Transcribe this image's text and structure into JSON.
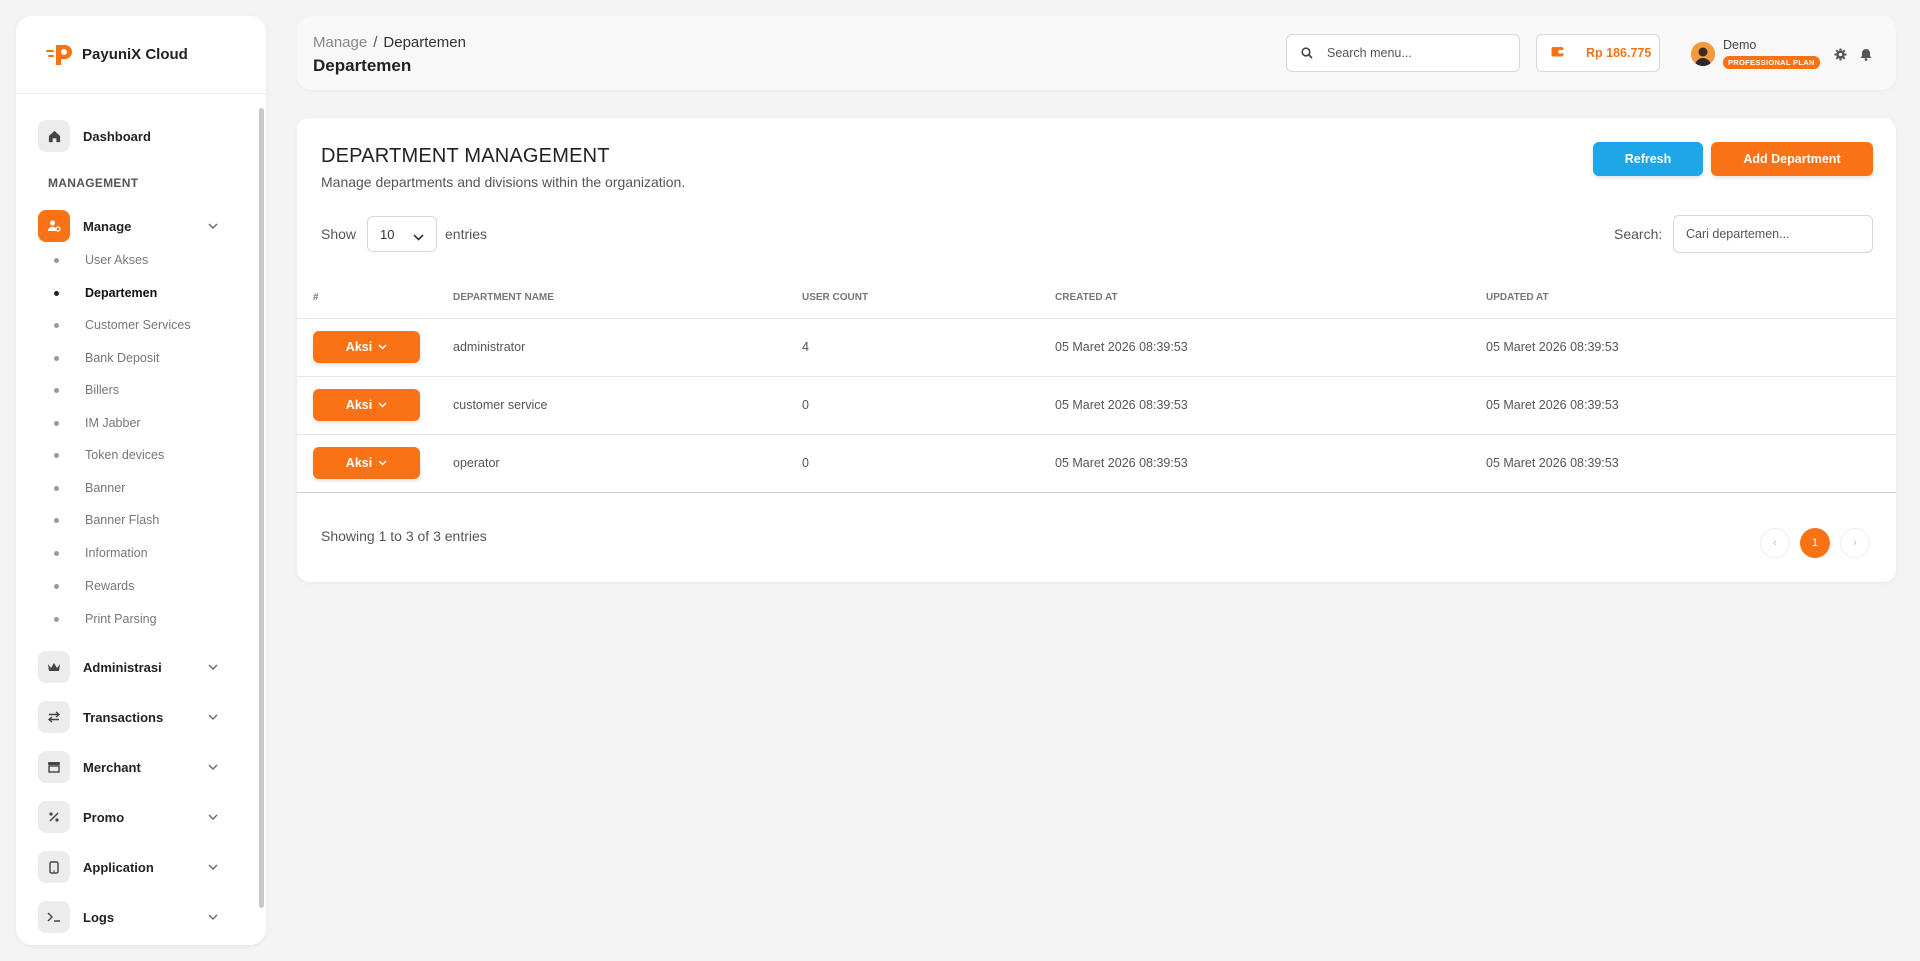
{
  "brand": {
    "name": "PayuniX Cloud"
  },
  "sidebar": {
    "dashboard": "Dashboard",
    "section": "MANAGEMENT",
    "manage": "Manage",
    "sub_items": [
      "User Akses",
      "Departemen",
      "Customer Services",
      "Bank Deposit",
      "Billers",
      "IM Jabber",
      "Token devices",
      "Banner",
      "Banner Flash",
      "Information",
      "Rewards",
      "Print Parsing"
    ],
    "groups": [
      "Administrasi",
      "Transactions",
      "Merchant",
      "Promo",
      "Application",
      "Logs"
    ]
  },
  "header": {
    "crumb_root": "Manage",
    "crumb_sep": "/",
    "crumb_current": "Departemen",
    "title": "Departemen",
    "search_placeholder": "Search menu...",
    "balance": "Rp 186.775",
    "user_name": "Demo",
    "plan": "PROFESSIONAL PLAN"
  },
  "card": {
    "title": "DEPARTMENT MANAGEMENT",
    "subtitle": "Manage departments and divisions within the organization.",
    "refresh_label": "Refresh",
    "add_label": "Add Department",
    "show_label": "Show",
    "show_value": "10",
    "entries_label": "entries",
    "search_label": "Search:",
    "search_placeholder": "Cari departemen..."
  },
  "table": {
    "columns": [
      "#",
      "DEPARTMENT NAME",
      "USER COUNT",
      "CREATED AT",
      "UPDATED AT"
    ],
    "action_label": "Aksi",
    "rows": [
      {
        "name": "administrator",
        "count": "4",
        "created": "05 Maret 2026 08:39:53",
        "updated": "05 Maret 2026 08:39:53"
      },
      {
        "name": "customer service",
        "count": "0",
        "created": "05 Maret 2026 08:39:53",
        "updated": "05 Maret 2026 08:39:53"
      },
      {
        "name": "operator",
        "count": "0",
        "created": "05 Maret 2026 08:39:53",
        "updated": "05 Maret 2026 08:39:53"
      }
    ]
  },
  "footer": {
    "info": "Showing 1 to 3 of 3 entries",
    "page": "1",
    "prev": "‹",
    "next": "›"
  },
  "colors": {
    "accent": "#f97316",
    "refresh": "#1ea7e8"
  }
}
